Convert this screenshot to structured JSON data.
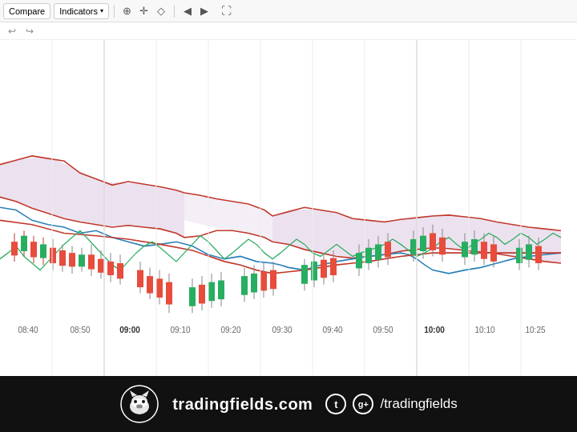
{
  "toolbar": {
    "compare_label": "Compare",
    "indicators_label": "Indicators",
    "indicators_arrow": "▾"
  },
  "undo_redo": {
    "undo": "↩",
    "redo": "↪"
  },
  "footer": {
    "brand": "tradingfields.com",
    "handle": "/tradingfields",
    "twitter_icon": "t",
    "gplus_icon": "g+"
  },
  "xaxis": {
    "labels": [
      {
        "text": "08:40",
        "bold": false
      },
      {
        "text": "08:50",
        "bold": false
      },
      {
        "text": "09:00",
        "bold": true
      },
      {
        "text": "09:10",
        "bold": false
      },
      {
        "text": "09:20",
        "bold": false
      },
      {
        "text": "09:30",
        "bold": false
      },
      {
        "text": "09:40",
        "bold": false
      },
      {
        "text": "09:50",
        "bold": false
      },
      {
        "text": "10:00",
        "bold": true
      },
      {
        "text": "10:10",
        "bold": false
      },
      {
        "text": "10:25",
        "bold": false
      }
    ]
  }
}
